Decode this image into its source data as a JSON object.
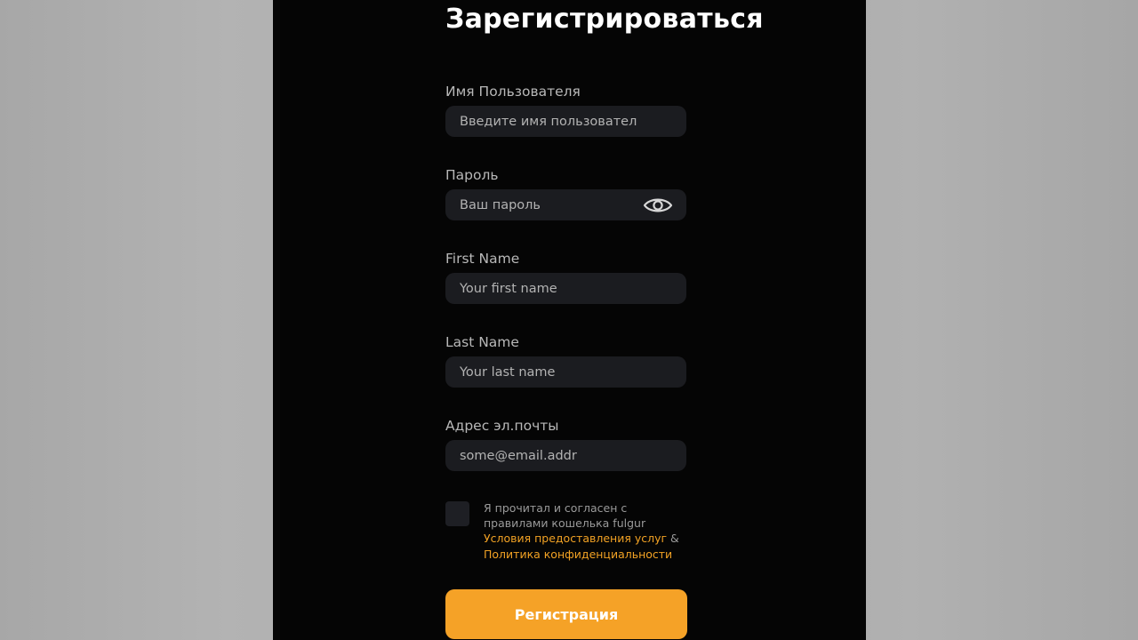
{
  "form": {
    "title": "Зарегистрироваться",
    "username": {
      "label": "Имя Пользователя",
      "placeholder": "Введите имя пользователя"
    },
    "password": {
      "label": "Пароль",
      "placeholder": "Ваш пароль",
      "toggle_icon": "eye-icon"
    },
    "first_name": {
      "label": "First Name",
      "placeholder": "Your first name"
    },
    "last_name": {
      "label": "Last Name",
      "placeholder": "Your last name"
    },
    "email": {
      "label": "Адрес эл.почты",
      "placeholder": "some@email.addr"
    },
    "agreement": {
      "text_line1": "Я прочитал и согласен с",
      "text_line2": "правилами кошелька fulgur",
      "terms_link": "Условия предоставления услуг",
      "separator": " &",
      "privacy_link": "Политика конфиденциальности"
    },
    "submit_label": "Регистрация"
  },
  "colors": {
    "panel_background": "#050505",
    "input_background": "#1b1c20",
    "accent": "#f5a227",
    "link": "#f2a224",
    "title_text": "#ffffff"
  }
}
